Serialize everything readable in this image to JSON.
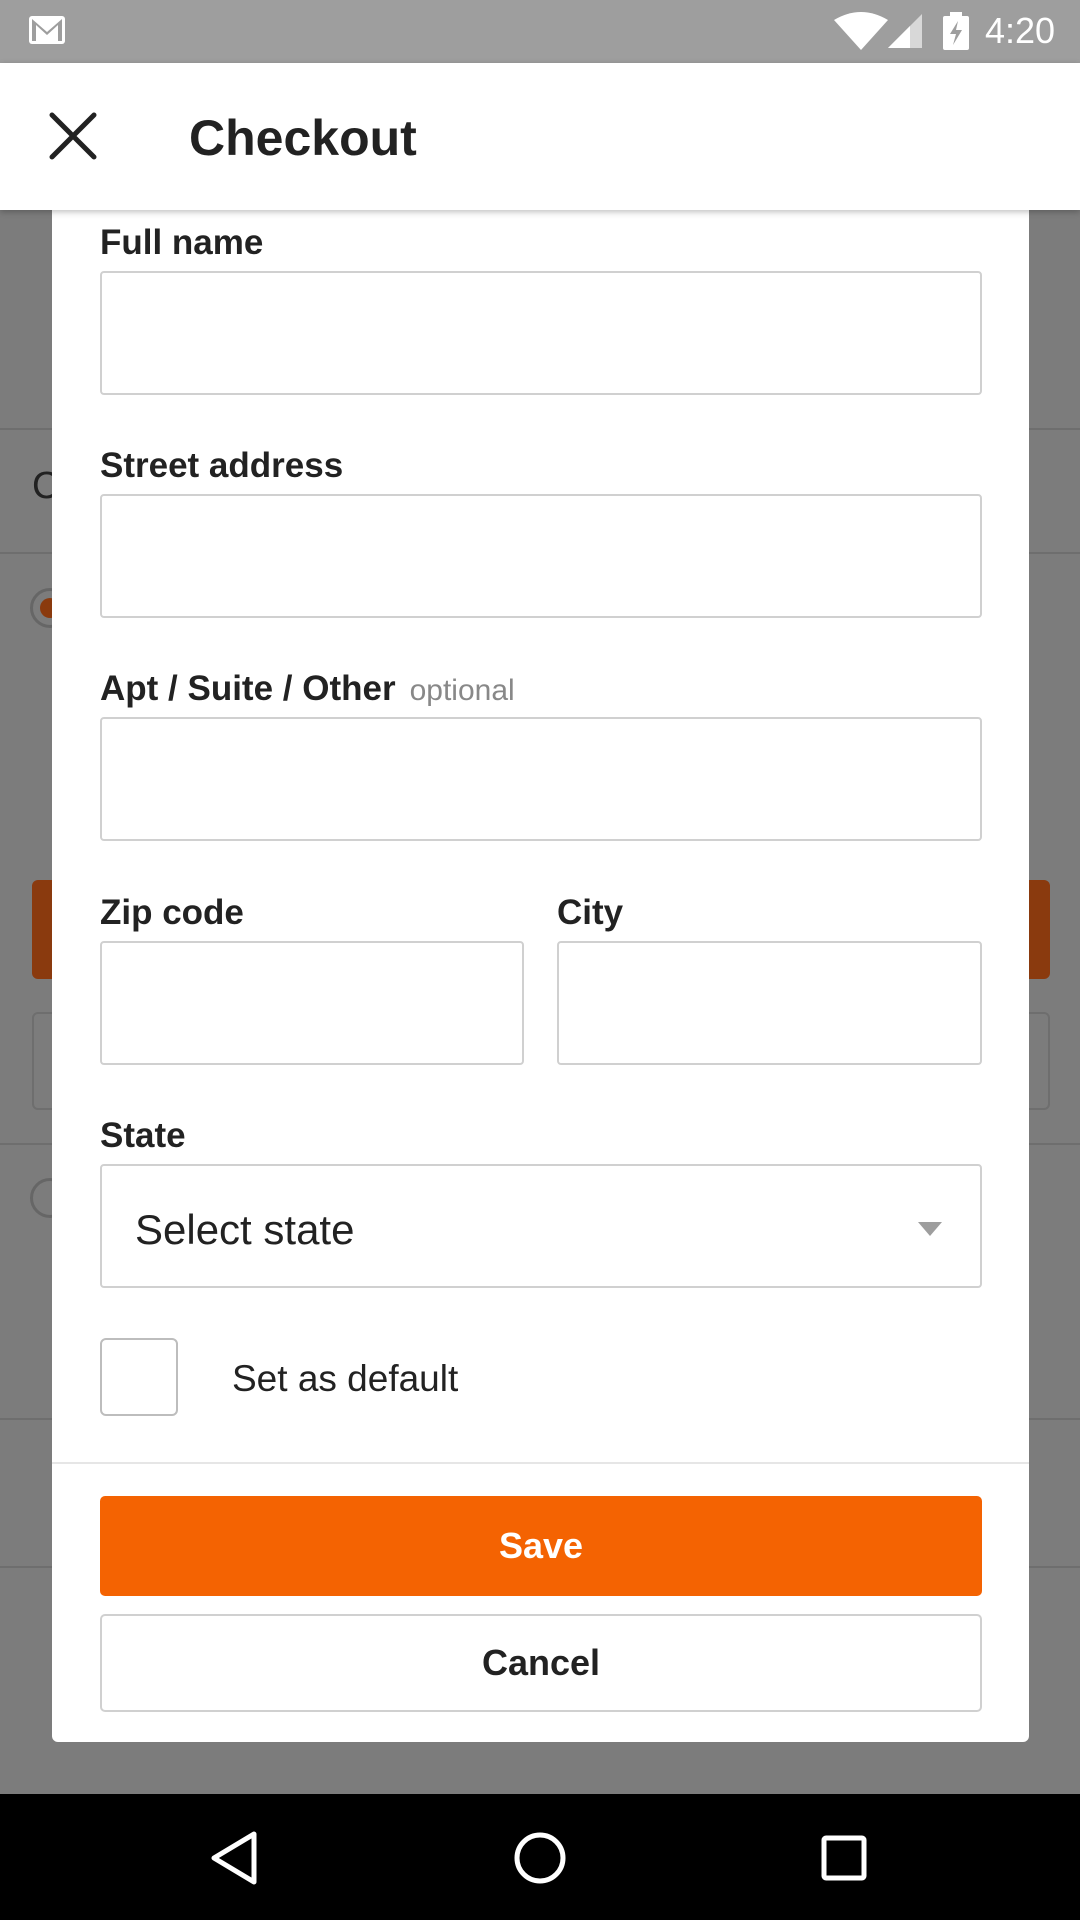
{
  "status_bar": {
    "time": "4:20",
    "icons": [
      "mail-icon",
      "wifi-icon",
      "signal-icon",
      "battery-charging-icon"
    ]
  },
  "app_bar": {
    "title": "Checkout",
    "close_icon": "close-icon"
  },
  "background": {
    "partial_text": "C"
  },
  "form": {
    "full_name": {
      "label": "Full name",
      "value": "",
      "placeholder": ""
    },
    "street_address": {
      "label": "Street address",
      "value": "",
      "placeholder": ""
    },
    "apt": {
      "label": "Apt / Suite / Other",
      "optional_label": "optional",
      "value": "",
      "placeholder": ""
    },
    "zip": {
      "label": "Zip code",
      "value": "",
      "placeholder": ""
    },
    "city": {
      "label": "City",
      "value": "",
      "placeholder": ""
    },
    "state": {
      "label": "State",
      "selected": "Select state",
      "icon": "dropdown-arrow-icon"
    },
    "default_checkbox": {
      "label": "Set as default",
      "checked": false
    }
  },
  "actions": {
    "save_label": "Save",
    "cancel_label": "Cancel"
  },
  "nav_bar": {
    "icons": [
      "back-icon",
      "home-icon",
      "recents-icon"
    ]
  },
  "colors": {
    "accent": "#f46302",
    "status_bar": "#9e9e9e",
    "scrim": "#7c7c7c",
    "border": "#d0d0d0"
  }
}
